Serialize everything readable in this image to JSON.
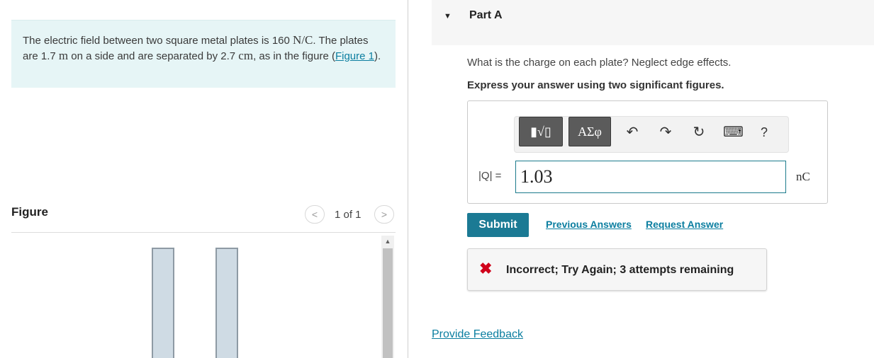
{
  "problem": {
    "text_1": "The electric field between two square metal plates is 160 ",
    "field_unit": "N/C",
    "text_2": ". The plates are 1.7 ",
    "length_unit": "m",
    "text_3": " on a side and are separated by 2.7 ",
    "sep_unit": "cm",
    "text_4": ", as in the figure (",
    "figure_link": "Figure 1",
    "text_5": ")."
  },
  "figure": {
    "title": "Figure",
    "counter": "1 of 1",
    "prev_glyph": "<",
    "next_glyph": ">"
  },
  "part": {
    "caret": "▼",
    "title": "Part A",
    "question": "What is the charge on each plate? Neglect edge effects.",
    "instruction": "Express your answer using two significant figures."
  },
  "toolbar": {
    "templates_label": "▮√▯",
    "greek_label": "ΑΣφ",
    "undo_icon": "↶",
    "redo_icon": "↷",
    "reset_icon": "↻",
    "keyboard_icon": "⌨",
    "help_label": "?"
  },
  "answer": {
    "label": "|Q| =",
    "value": "1.03",
    "unit": "nC"
  },
  "actions": {
    "submit": "Submit",
    "previous_answers": "Previous Answers",
    "request_answer": "Request Answer"
  },
  "feedback": {
    "icon": "✖",
    "message": "Incorrect; Try Again; 3 attempts remaining"
  },
  "footer": {
    "provide_feedback": "Provide Feedback"
  },
  "colors": {
    "accent": "#1b7a94",
    "link": "#0b7ea0",
    "error": "#d0021b",
    "problem_bg": "#e6f5f6"
  }
}
